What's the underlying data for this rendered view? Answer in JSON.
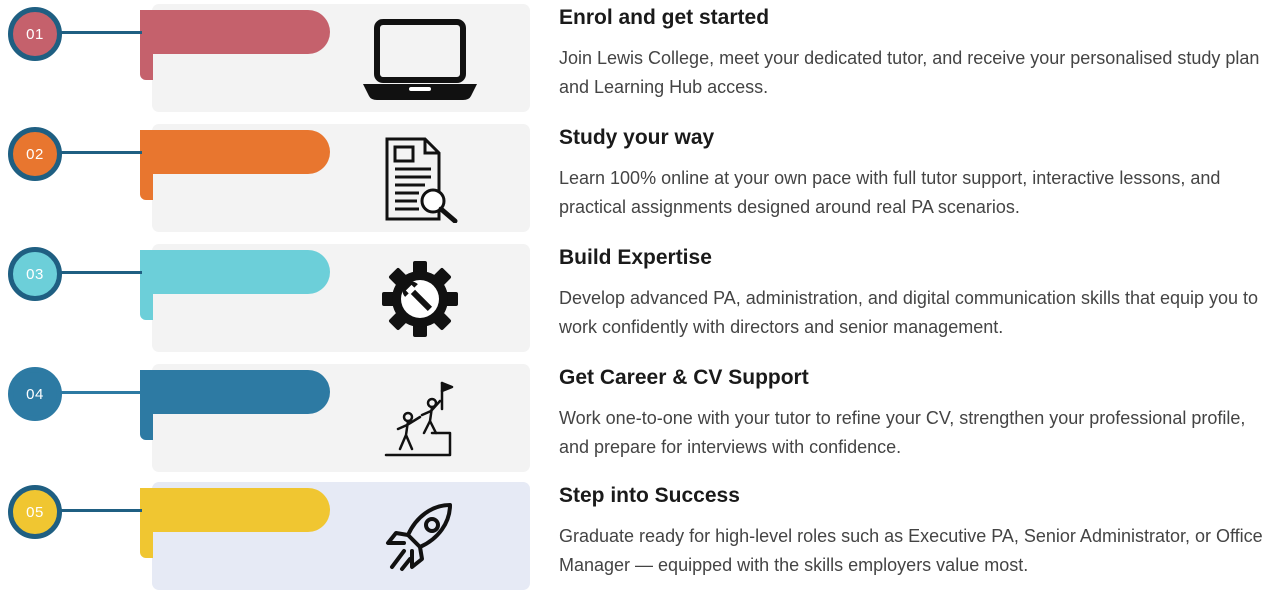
{
  "steps": [
    {
      "number": "01",
      "title": "Enrol and get started",
      "description": "Join Lewis College, meet your dedicated tutor, and receive your personalised study plan and Learning Hub access.",
      "icon": "laptop-icon",
      "color": "#c5616c",
      "connector_color": "#1f5f82",
      "badge_border": "#1f5f82"
    },
    {
      "number": "02",
      "title": "Study your way",
      "description": "Learn 100% online at your own pace with full tutor support, interactive lessons, and practical assignments designed around real PA scenarios.",
      "icon": "document-search-icon",
      "color": "#e8762f",
      "connector_color": "#1f5f82",
      "badge_border": "#1f5f82"
    },
    {
      "number": "03",
      "title": "Build Expertise",
      "description": "Develop advanced PA, administration, and digital communication skills that equip you to work confidently with directors and senior management.",
      "icon": "gear-wrench-icon",
      "color": "#6ccfd9",
      "connector_color": "#1f5f82",
      "badge_border": "#1f5f82"
    },
    {
      "number": "04",
      "title": "Get Career & CV Support",
      "description": "Work one-to-one with your tutor to refine your CV, strengthen your professional profile, and prepare for interviews with confidence.",
      "icon": "climbers-icon",
      "color": "#2d7aa3",
      "connector_color": "#2d7aa3",
      "badge_border": "#2d7aa3"
    },
    {
      "number": "05",
      "title": "Step into Success",
      "description": "Graduate ready for high-level roles such as Executive PA, Senior Administrator, or Office Manager — equipped with the skills employers value most.",
      "icon": "rocket-icon",
      "color": "#f0c631",
      "connector_color": "#1f5f82",
      "badge_border": "#1f5f82"
    }
  ]
}
